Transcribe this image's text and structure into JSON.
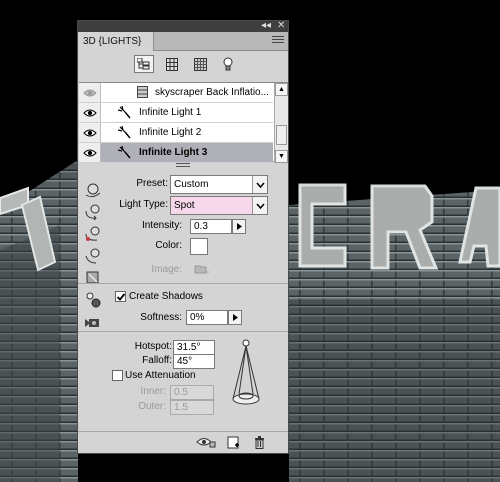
{
  "panel": {
    "tab_label": "3D {LIGHTS}",
    "top_controls": {
      "collapse": "◂◂",
      "close": "✕"
    }
  },
  "filters": [
    {
      "icon": "scene-filter-icon",
      "active": true
    },
    {
      "icon": "mesh-filter-icon",
      "active": false
    },
    {
      "icon": "material-filter-icon",
      "active": false
    },
    {
      "icon": "light-filter-icon",
      "active": false
    }
  ],
  "layers": [
    {
      "label": "skyscraper Back Inflatio...",
      "visible": false,
      "selected": false
    },
    {
      "label": "Infinite Light 1",
      "visible": true,
      "selected": false
    },
    {
      "label": "Infinite Light 2",
      "visible": true,
      "selected": false
    },
    {
      "label": "Infinite Light 3",
      "visible": true,
      "selected": true
    }
  ],
  "props": {
    "preset_label": "Preset:",
    "preset_value": "Custom",
    "light_type_label": "Light Type:",
    "light_type_value": "Spot",
    "intensity_label": "Intensity:",
    "intensity_value": "0.3",
    "color_label": "Color:",
    "image_label": "Image:",
    "create_shadows_label": "Create Shadows",
    "create_shadows_checked": true,
    "softness_label": "Softness:",
    "softness_value": "0%",
    "hotspot_label": "Hotspot:",
    "hotspot_value": "31.5°",
    "falloff_label": "Falloff:",
    "falloff_value": "45°",
    "use_attenuation_label": "Use Attenuation",
    "use_attenuation_checked": false,
    "inner_label": "Inner:",
    "inner_value": "0.5",
    "outer_label": "Outer:",
    "outer_value": "1.5"
  },
  "colors": {
    "light_color": "#ffffff",
    "light_type_bg": "#f7d7ea",
    "selected_row": "#b0b0b8"
  }
}
